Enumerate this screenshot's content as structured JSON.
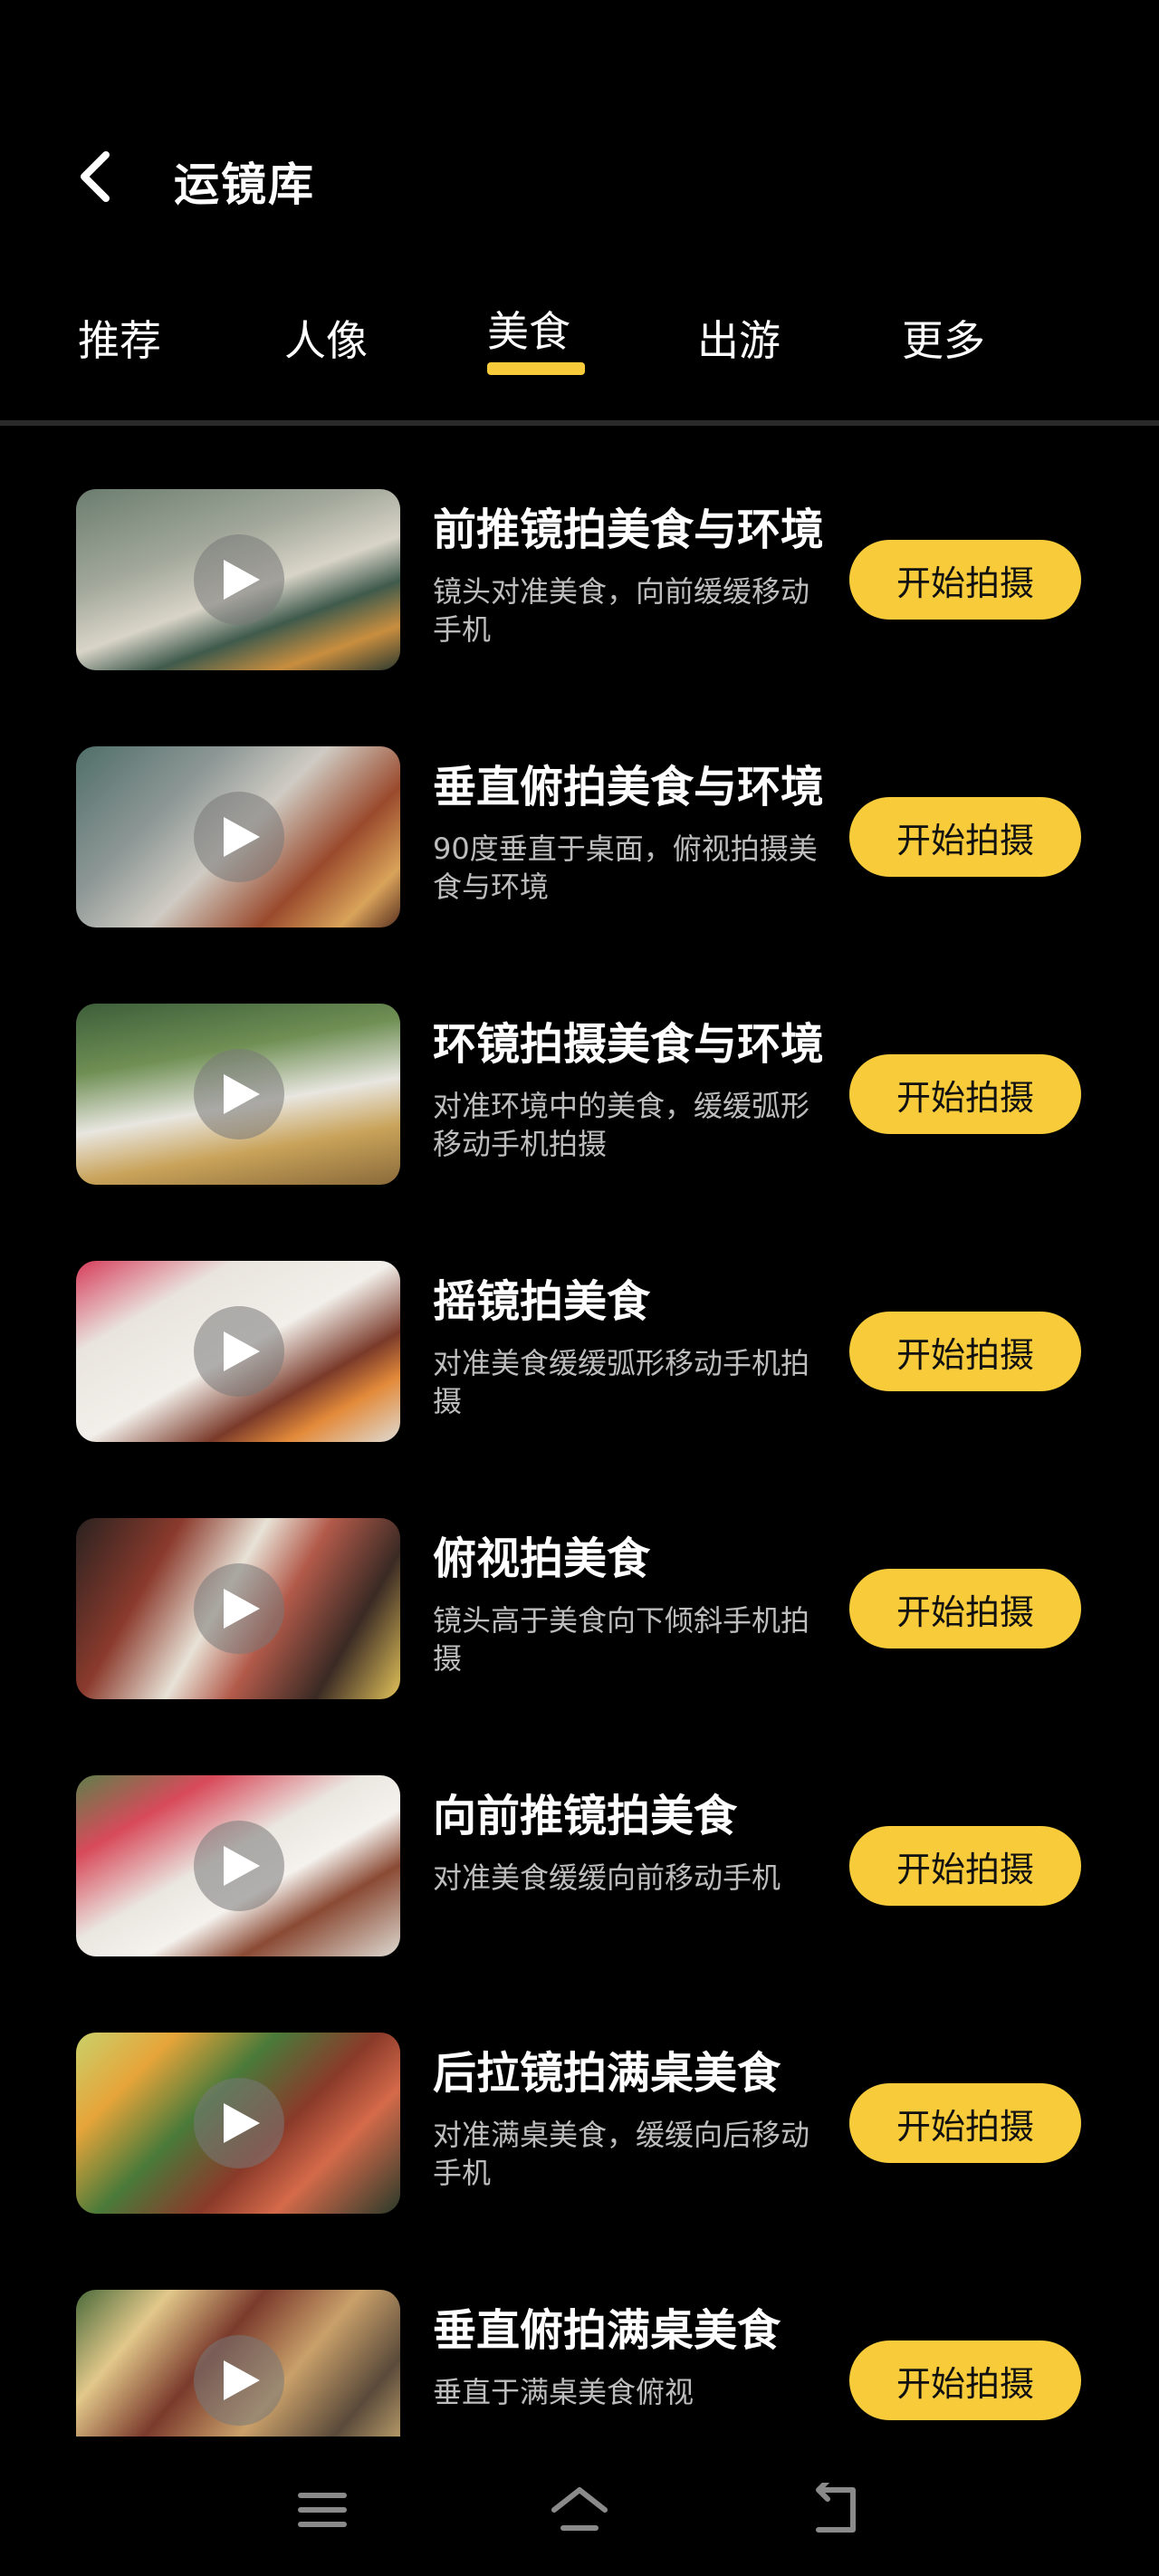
{
  "header": {
    "title": "运镜库"
  },
  "tabs": [
    {
      "label": "推荐",
      "active": false
    },
    {
      "label": "人像",
      "active": false
    },
    {
      "label": "美食",
      "active": true
    },
    {
      "label": "出游",
      "active": false
    },
    {
      "label": "更多",
      "active": false
    }
  ],
  "colors": {
    "accent": "#F7CB3A",
    "background": "#000000"
  },
  "items": [
    {
      "title": "前推镜拍美食与环境",
      "desc": "镜头对准美食，向前缓缓移动手机",
      "button": "开始拍摄"
    },
    {
      "title": "垂直俯拍美食与环境",
      "desc": "90度垂直于桌面，俯视拍摄美食与环境",
      "button": "开始拍摄"
    },
    {
      "title": "环镜拍摄美食与环境",
      "desc": "对准环境中的美食，缓缓弧形移动手机拍摄",
      "button": "开始拍摄"
    },
    {
      "title": "摇镜拍美食",
      "desc": "对准美食缓缓弧形移动手机拍摄",
      "button": "开始拍摄"
    },
    {
      "title": "俯视拍美食",
      "desc": "镜头高于美食向下倾斜手机拍摄",
      "button": "开始拍摄"
    },
    {
      "title": "向前推镜拍美食",
      "desc": "对准美食缓缓向前移动手机",
      "button": "开始拍摄"
    },
    {
      "title": "后拉镜拍满桌美食",
      "desc": "对准满桌美食，缓缓向后移动手机",
      "button": "开始拍摄"
    },
    {
      "title": "垂直俯拍满桌美食",
      "desc": "垂直于满桌美食俯视",
      "button": "开始拍摄"
    }
  ],
  "nav": {
    "menu_icon": "menu-icon",
    "home_icon": "home-icon",
    "back_icon": "back-icon"
  }
}
